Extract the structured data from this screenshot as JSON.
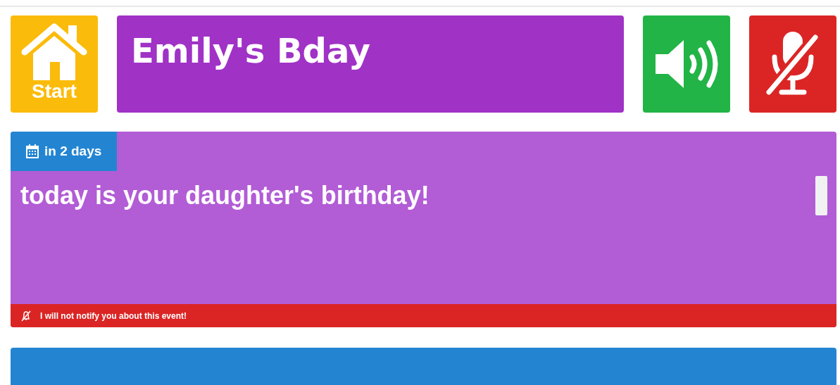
{
  "start_button": {
    "label": "Start"
  },
  "title": "Emily's Bday",
  "speaker": {
    "on": true
  },
  "microphone": {
    "muted": true
  },
  "event": {
    "when": "in 2 days",
    "message": "today is your daughter's birthday!",
    "notify": false,
    "notice": "I will not notify you about this event!"
  }
}
